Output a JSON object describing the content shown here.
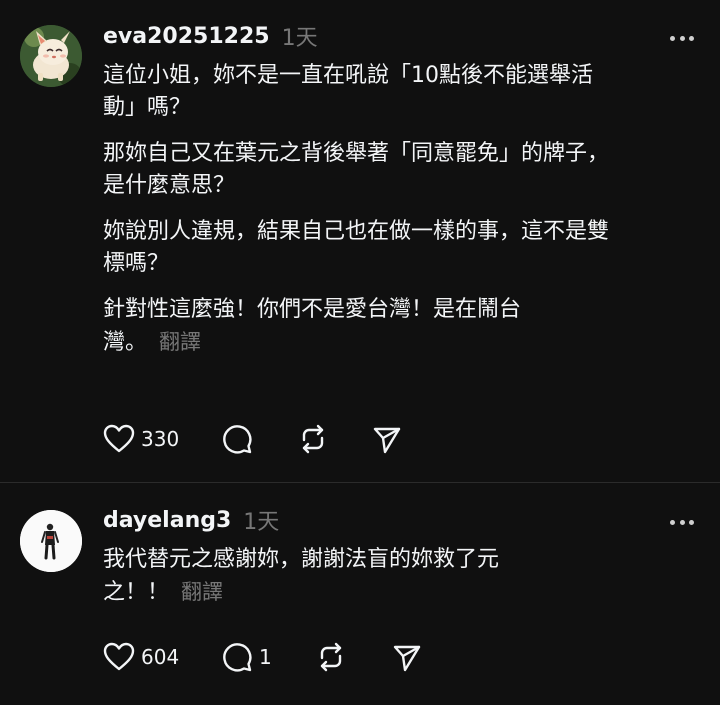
{
  "posts": [
    {
      "username": "eva20251225",
      "time": "1天",
      "avatar_icon": "anime-character-avatar",
      "paragraphs": [
        "這位小姐，妳不是一直在吼說「10點後不能選舉活\n動」嗎？",
        "那妳自己又在葉元之背後舉著「同意罷免」的牌子，\n是什麼意思？",
        "妳說別人違規，結果自己也在做一樣的事，這不是雙\n標嗎？",
        "針對性這麼強！你們不是愛台灣！是在鬧台\n灣。"
      ],
      "translate_label": "翻譯",
      "likes": "330",
      "replies": "",
      "reposts": ""
    },
    {
      "username": "dayelang3",
      "time": "1天",
      "avatar_icon": "person-silhouette-avatar",
      "paragraphs": [
        "我代替元之感謝妳，謝謝法盲的妳救了元\n之！！"
      ],
      "translate_label": "翻譯",
      "likes": "604",
      "replies": "1",
      "reposts": ""
    }
  ],
  "colors": {
    "background": "#101010",
    "text": "#f3f5f7",
    "muted": "#777777",
    "divider": "#2b2b2b"
  }
}
